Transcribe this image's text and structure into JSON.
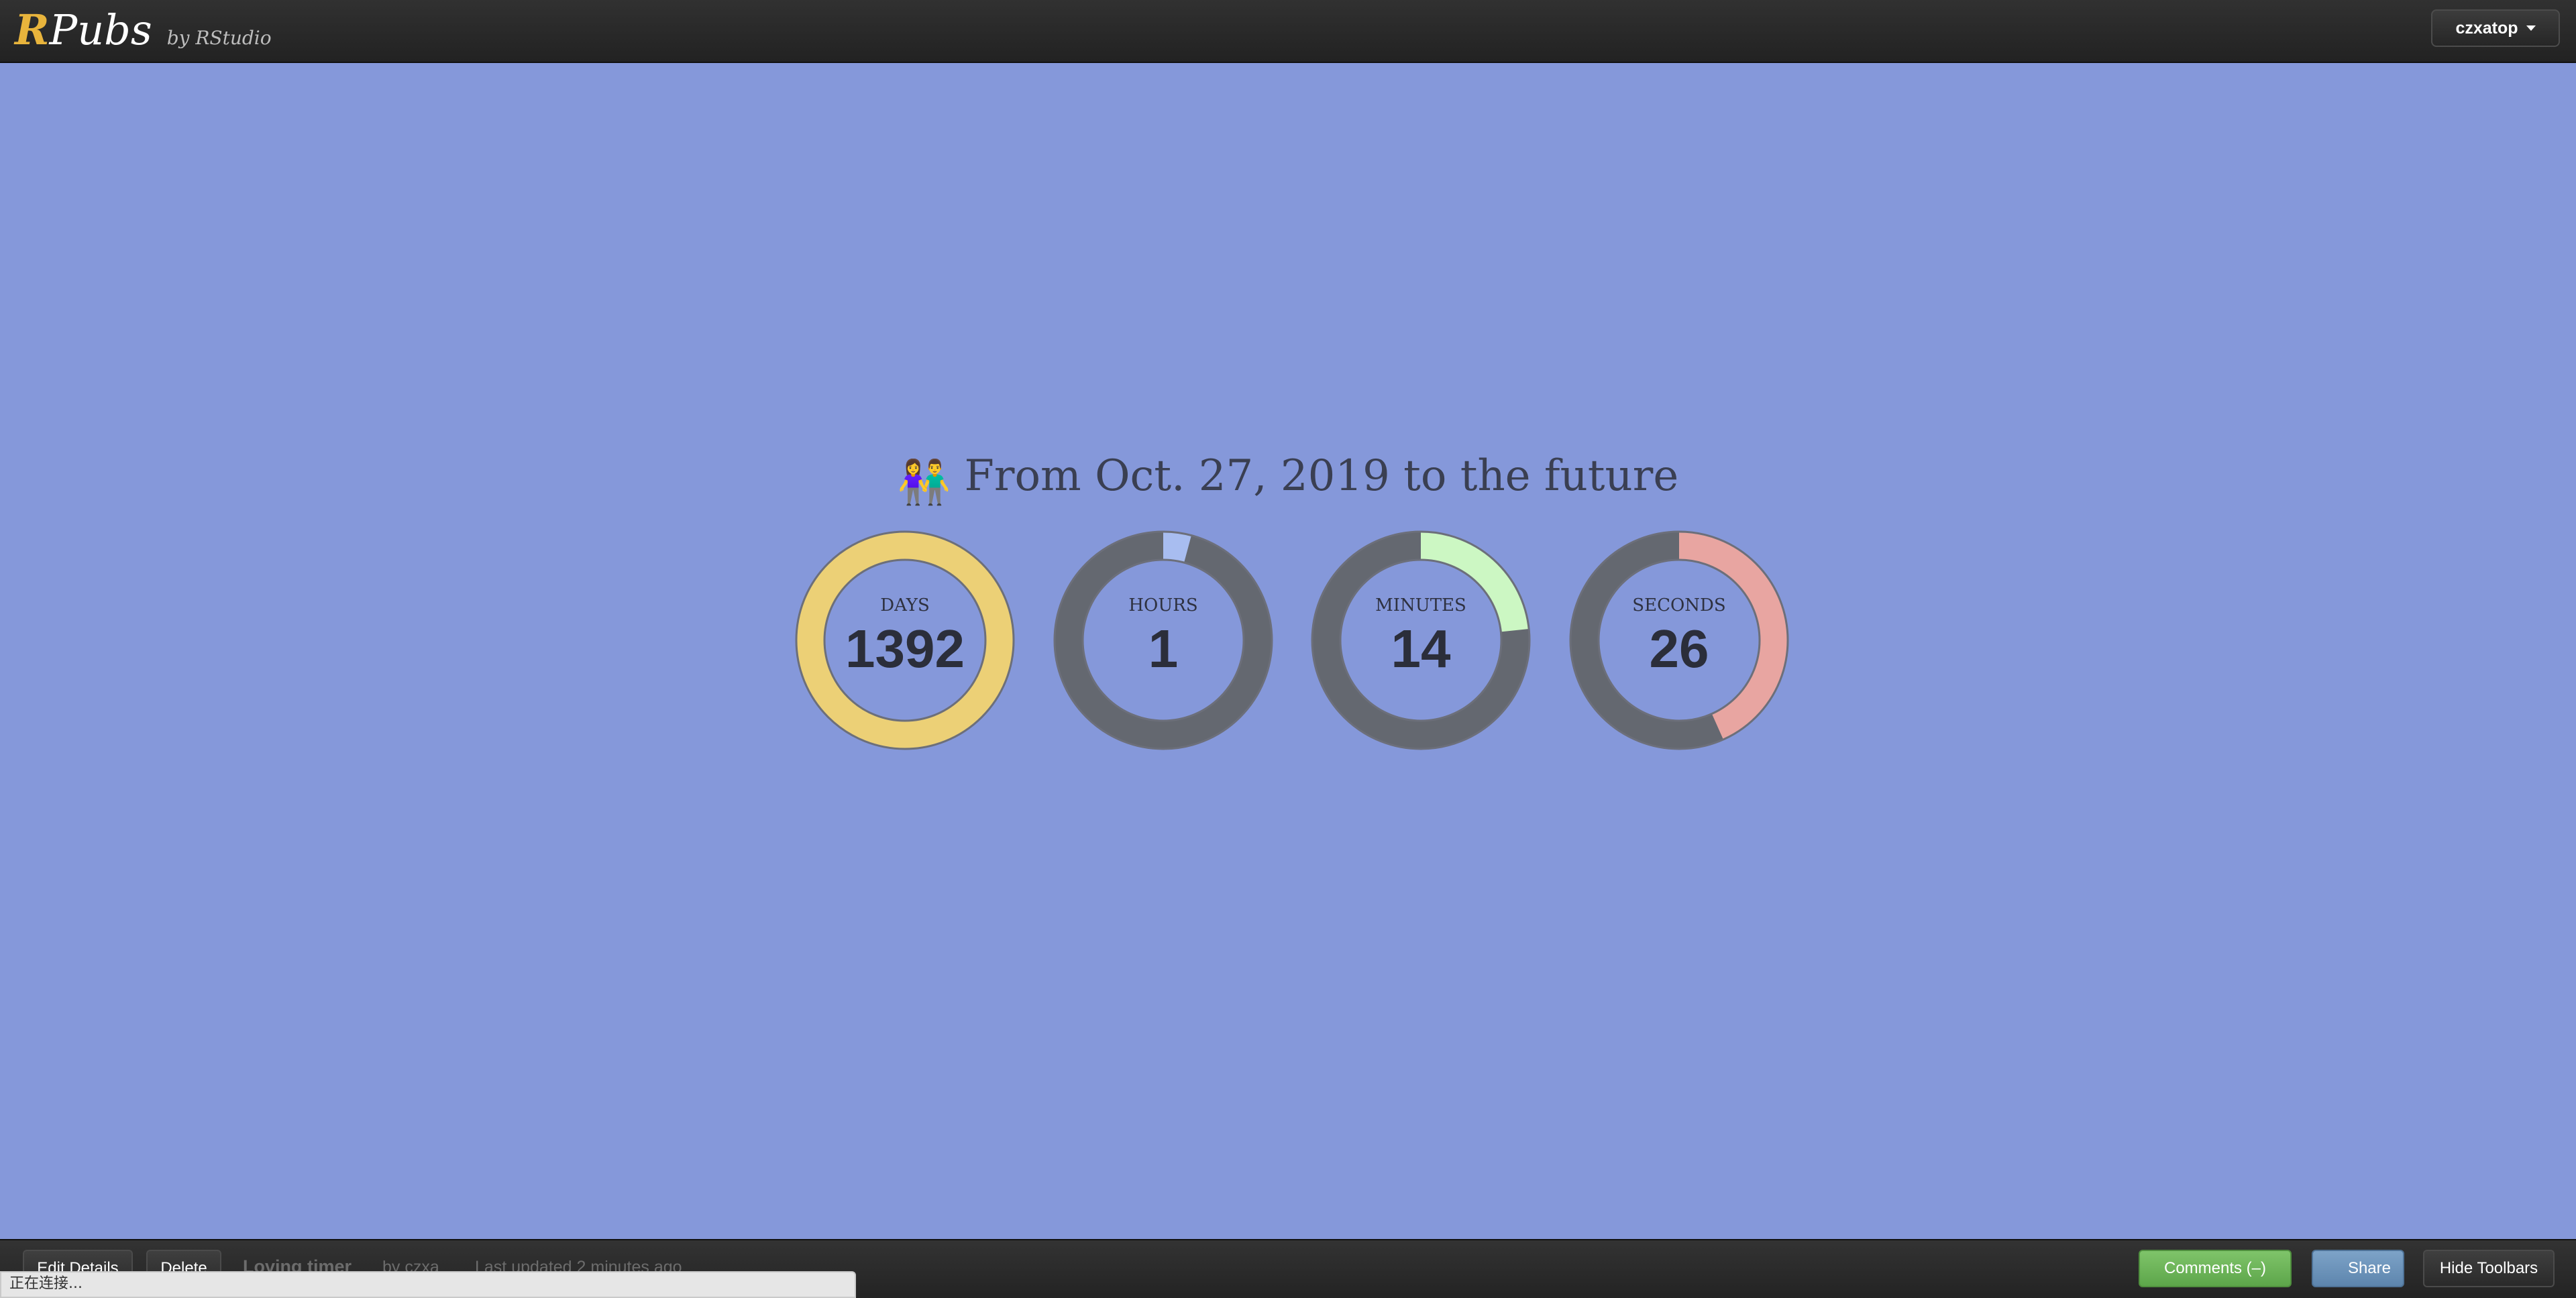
{
  "topbar": {
    "logo_r": "R",
    "logo_pubs": "Pubs",
    "logo_by": "by RStudio",
    "user_menu": "czxatop"
  },
  "main": {
    "title_emoji": "👫",
    "title": "From Oct. 27, 2019 to the future",
    "counters": [
      {
        "label": "DAYS",
        "value": "1392",
        "fraction": 1.0,
        "color": "#ecd076"
      },
      {
        "label": "HOURS",
        "value": "1",
        "fraction": 0.0417,
        "color": "#a8bdf0"
      },
      {
        "label": "MINUTES",
        "value": "14",
        "fraction": 0.2333,
        "color": "#ccf7c3"
      },
      {
        "label": "SECONDS",
        "value": "26",
        "fraction": 0.4333,
        "color": "#e8a5a1"
      }
    ],
    "track_color": "#646870"
  },
  "bottombar": {
    "edit_label": "Edit Details",
    "delete_label": "Delete",
    "doc_title": "Loving timer",
    "author": "by czxa",
    "updated": "Last updated 2 minutes ago",
    "comments_label": "Comments (–)",
    "share_label": "Share",
    "hide_label": "Hide Toolbars"
  },
  "status_text": "正在连接..."
}
